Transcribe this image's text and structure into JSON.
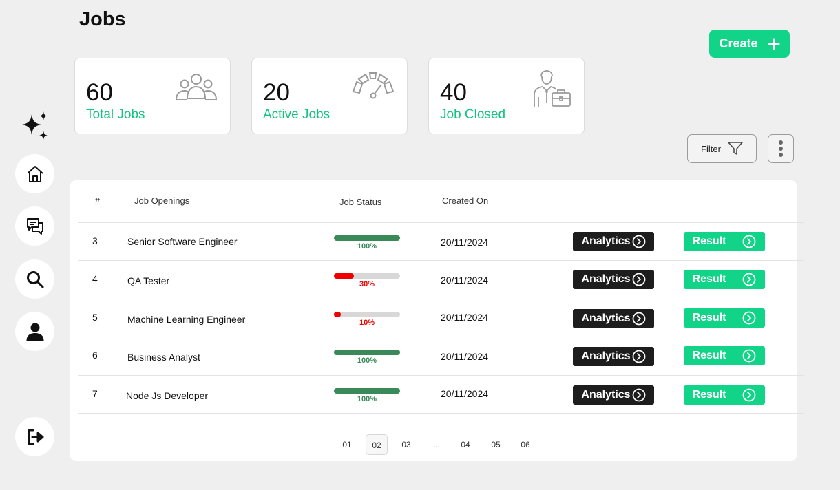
{
  "header": {
    "title": "Jobs",
    "create_label": "Create"
  },
  "stats": [
    {
      "value": "60",
      "label": "Total Jobs",
      "icon": "team-icon"
    },
    {
      "value": "20",
      "label": "Active Jobs",
      "icon": "gauge-icon"
    },
    {
      "value": "40",
      "label": "Job Closed",
      "icon": "businessman-icon"
    }
  ],
  "toolbar": {
    "filter_label": "Filter"
  },
  "table": {
    "headers": [
      "#",
      "Job Openings",
      "Job Status",
      "Created On"
    ],
    "rows": [
      {
        "id": "3",
        "title": "Senior Software Engineer",
        "progress": 100,
        "progress_label": "100%",
        "status_color": "#3a8a59",
        "created": "20/11/2024",
        "analytics": "Analytics",
        "result": "Result"
      },
      {
        "id": "4",
        "title": "QA Tester",
        "progress": 30,
        "progress_label": "30%",
        "status_color": "#f00000",
        "created": "20/11/2024",
        "analytics": "Analytics",
        "result": "Result"
      },
      {
        "id": "5",
        "title": "Machine Learning Engineer",
        "progress": 10,
        "progress_label": "10%",
        "status_color": "#f00000",
        "created": "20/11/2024",
        "analytics": "Analytics",
        "result": "Result"
      },
      {
        "id": "6",
        "title": "Business Analyst",
        "progress": 100,
        "progress_label": "100%",
        "status_color": "#3a8a59",
        "created": "20/11/2024",
        "analytics": "Analytics",
        "result": "Result"
      },
      {
        "id": "7",
        "title": "Node Js Developer",
        "progress": 100,
        "progress_label": "100%",
        "status_color": "#3a8a59",
        "created": "20/11/2024",
        "analytics": "Analytics",
        "result": "Result"
      }
    ]
  },
  "pagination": {
    "pages": [
      "01",
      "02",
      "03",
      "...",
      "04",
      "05",
      "06"
    ],
    "current": "02"
  },
  "colors": {
    "accent": "#12d488",
    "complete": "#3a8a59",
    "low": "#f00000",
    "dark_button": "#1d1d1d"
  }
}
